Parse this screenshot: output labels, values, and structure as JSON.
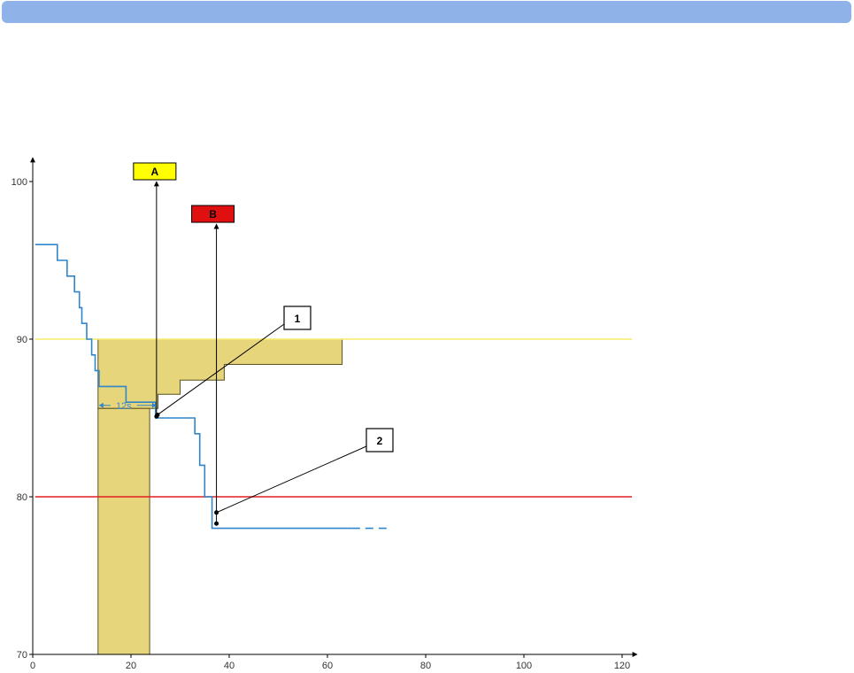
{
  "colors": {
    "topbar": "#8fb3e8",
    "spo2_line": "#2f86cc",
    "yellow_line": "#f5ec6c",
    "red_line": "#e02020",
    "yellow_fill": "#e6d57a",
    "marker_a": "#ffff00",
    "marker_b": "#e01010",
    "axis": "#000000"
  },
  "chart_data": {
    "type": "line",
    "title": "",
    "xlabel": "",
    "ylabel": "",
    "xlim": [
      0,
      122
    ],
    "ylim": [
      70,
      101.5
    ],
    "x_ticks": [
      0,
      20,
      40,
      60,
      80,
      100,
      120
    ],
    "y_ticks": [
      70,
      80,
      90,
      100
    ],
    "grid": false,
    "series": [
      {
        "step_points": [
          [
            0.5,
            96
          ],
          [
            5,
            96
          ],
          [
            5,
            95
          ],
          [
            7,
            95
          ],
          [
            7,
            94
          ],
          [
            8.5,
            94
          ],
          [
            8.5,
            93
          ],
          [
            9.5,
            93
          ],
          [
            9.5,
            92
          ],
          [
            10,
            92
          ],
          [
            10,
            91
          ],
          [
            11,
            91
          ],
          [
            11,
            90
          ],
          [
            12,
            90
          ],
          [
            12,
            89
          ],
          [
            12.7,
            89
          ],
          [
            12.7,
            88
          ],
          [
            13.5,
            88
          ],
          [
            13.5,
            87
          ],
          [
            19,
            87
          ],
          [
            19,
            86
          ],
          [
            25,
            86
          ],
          [
            25,
            85
          ],
          [
            33,
            85
          ],
          [
            33,
            84
          ],
          [
            34,
            84
          ],
          [
            34,
            82
          ],
          [
            35,
            82
          ],
          [
            35,
            80
          ],
          [
            36.5,
            80
          ],
          [
            36.5,
            78
          ],
          [
            65,
            78
          ]
        ],
        "dashed_extension": [
          [
            65,
            78
          ],
          [
            73,
            78
          ]
        ]
      }
    ],
    "thresholds": [
      {
        "y": 90,
        "x": [
          0.5,
          122
        ],
        "color": "yellow"
      },
      {
        "y": 80,
        "x": [
          0.5,
          122
        ],
        "color": "red"
      }
    ],
    "shaded_regions": [
      {
        "name": "area",
        "points": [
          [
            13.3,
            90
          ],
          [
            63,
            90
          ],
          [
            63,
            88.4
          ],
          [
            39,
            88.4
          ],
          [
            39,
            87.4
          ],
          [
            30,
            87.4
          ],
          [
            30,
            86.5
          ],
          [
            25.5,
            86.5
          ],
          [
            25.5,
            85.6
          ],
          [
            13.3,
            85.6
          ]
        ]
      },
      {
        "name": "band",
        "points": [
          [
            13.3,
            85.6
          ],
          [
            23.8,
            85.6
          ],
          [
            23.8,
            70
          ],
          [
            13.3,
            70
          ]
        ]
      }
    ],
    "markers": [
      {
        "label": "A",
        "x": 25.2,
        "top_y": 100,
        "bottom_y": 85.1
      },
      {
        "label": "B",
        "x": 37.4,
        "top_y": 97.3,
        "bottom_y": 78.3
      }
    ],
    "callouts": [
      {
        "label": "1",
        "point": [
          25.4,
          85.2
        ]
      },
      {
        "label": "2",
        "point": [
          37.4,
          79
        ]
      }
    ],
    "annotations": [
      {
        "text": "12s",
        "span": [
          13.3,
          25.2
        ],
        "y": 85.8
      }
    ]
  }
}
